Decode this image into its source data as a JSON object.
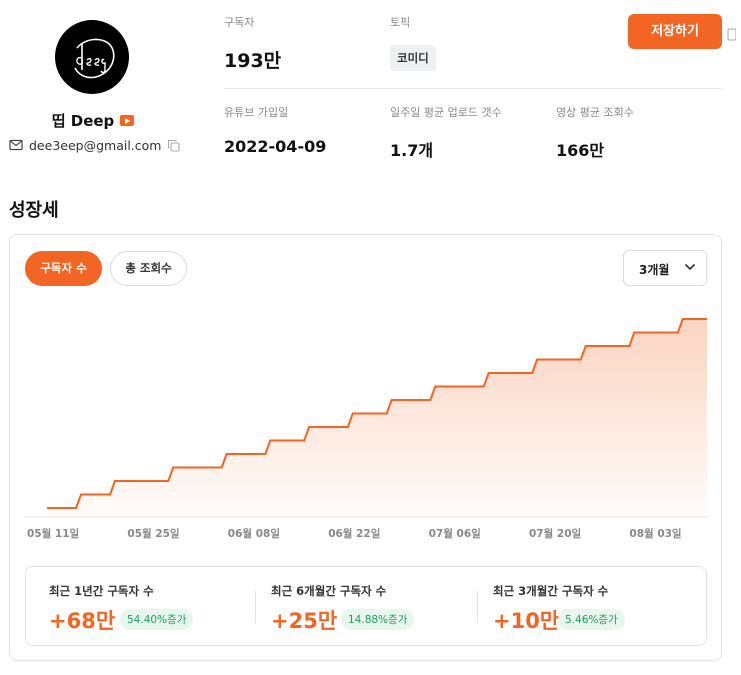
{
  "profile": {
    "channel_name": "띱 Deep",
    "email": "dee3eep@gmail.com",
    "badge_icon": "youtube-icon"
  },
  "stats": {
    "subscribers_label": "구독자",
    "subscribers_value": "193만",
    "topic_label": "토픽",
    "topic_value": "코미디",
    "joined_label": "유튜브 가입일",
    "joined_value": "2022-04-09",
    "weekly_uploads_label": "일주일 평균 업로드 갯수",
    "weekly_uploads_value": "1.7개",
    "avg_views_label": "영상 평균 조회수",
    "avg_views_value": "166만"
  },
  "actions": {
    "save_label": "저장하기"
  },
  "growth": {
    "title": "성장세",
    "tabs": [
      "구독자 수",
      "총 조회수"
    ],
    "active_tab": "구독자 수",
    "period": "3개월"
  },
  "colors": {
    "accent": "#f26522",
    "positive": "#1e9e5a",
    "positive_bg": "#e8f7ee"
  },
  "chart_data": {
    "type": "area",
    "x_ticks": [
      "05월 11일",
      "05월 25일",
      "06월 08일",
      "06월 22일",
      "07월 06일",
      "07월 20일",
      "08월 03일"
    ],
    "series": [
      {
        "x": [
          0,
          7,
          14,
          21,
          28,
          35,
          42,
          49,
          56,
          63,
          70,
          77,
          84,
          91,
          98
        ],
        "y": [
          0,
          0.1,
          0.2,
          0.3,
          0.4,
          0.5,
          0.6,
          0.7,
          0.8,
          0.9,
          1.0,
          1.1,
          1.2,
          1.3,
          1.4
        ],
        "step": [
          [
            0,
            0.0
          ],
          [
            6,
            0.0
          ],
          [
            7,
            0.1
          ],
          [
            13,
            0.1
          ],
          [
            14,
            0.2
          ],
          [
            25,
            0.2
          ],
          [
            26,
            0.3
          ],
          [
            36,
            0.3
          ],
          [
            37,
            0.4
          ],
          [
            45,
            0.4
          ],
          [
            46,
            0.5
          ],
          [
            53,
            0.5
          ],
          [
            54,
            0.6
          ],
          [
            62,
            0.6
          ],
          [
            63,
            0.7
          ],
          [
            70,
            0.7
          ],
          [
            71,
            0.8
          ],
          [
            79,
            0.8
          ],
          [
            80,
            0.9
          ],
          [
            90,
            0.9
          ],
          [
            91,
            1.0
          ],
          [
            100,
            1.0
          ],
          [
            101,
            1.1
          ],
          [
            110,
            1.1
          ],
          [
            111,
            1.2
          ],
          [
            120,
            1.2
          ],
          [
            121,
            1.3
          ],
          [
            130,
            1.3
          ],
          [
            131,
            1.4
          ],
          [
            136,
            1.4
          ]
        ]
      }
    ],
    "grid": false,
    "legend": "none"
  },
  "summary": [
    {
      "label": "최근 1년간 구독자 수",
      "value": "+68만",
      "pct": "54.40%증가"
    },
    {
      "label": "최근 6개월간 구독자 수",
      "value": "+25만",
      "pct": "14.88%증가"
    },
    {
      "label": "최근 3개월간 구독자 수",
      "value": "+10만",
      "pct": "5.46%증가"
    }
  ]
}
